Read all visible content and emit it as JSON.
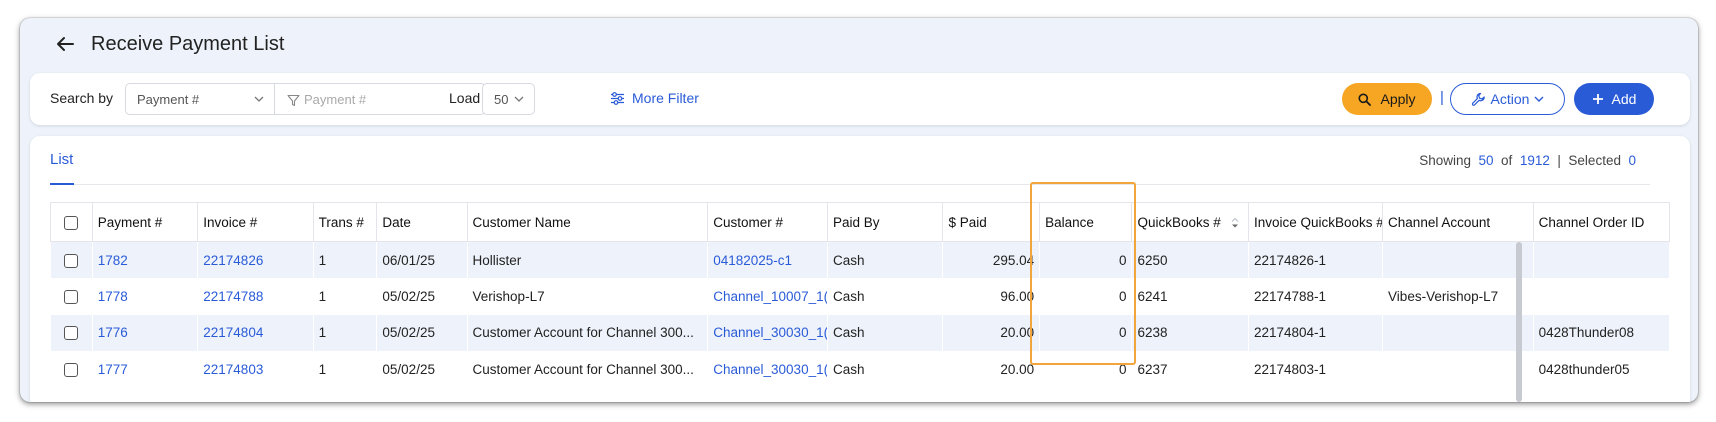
{
  "page": {
    "title": "Receive Payment List"
  },
  "filters": {
    "search_by_label": "Search by",
    "search_by_value": "Payment #",
    "search_placeholder": "Payment #",
    "load_label": "Load",
    "load_value": "50",
    "more_filter_label": "More Filter"
  },
  "actions": {
    "apply_label": "Apply",
    "separator": "|",
    "action_label": "Action",
    "add_label": "Add"
  },
  "list": {
    "tab_label": "List",
    "showing_label": "Showing",
    "showing_count": "50",
    "of_label": "of",
    "total": "1912",
    "sep": "|",
    "selected_label": "Selected",
    "selected_count": "0"
  },
  "table": {
    "columns": [
      "Payment #",
      "Invoice #",
      "Trans #",
      "Date",
      "Customer Name",
      "Customer #",
      "Paid By",
      "$ Paid",
      "Balance",
      "QuickBooks #",
      "Invoice QuickBooks #",
      "Channel Account",
      "Channel Order ID"
    ],
    "rows": [
      {
        "payment": "1782",
        "invoice": "22174826",
        "trans": "1",
        "date": "06/01/25",
        "customer_name": "Hollister",
        "customer_no": "04182025-c1",
        "paid_by": "Cash",
        "paid": "295.04",
        "balance": "0",
        "qb": "6250",
        "invoice_qb": "22174826-1",
        "channel_account": "",
        "channel_order": ""
      },
      {
        "payment": "1778",
        "invoice": "22174788",
        "trans": "1",
        "date": "05/02/25",
        "customer_name": "Verishop-L7",
        "customer_no": "Channel_10007_1(",
        "paid_by": "Cash",
        "paid": "96.00",
        "balance": "0",
        "qb": "6241",
        "invoice_qb": "22174788-1",
        "channel_account": "Vibes-Verishop-L7",
        "channel_order": ""
      },
      {
        "payment": "1776",
        "invoice": "22174804",
        "trans": "1",
        "date": "05/02/25",
        "customer_name": "Customer Account for Channel 300...",
        "customer_no": "Channel_30030_1(",
        "paid_by": "Cash",
        "paid": "20.00",
        "balance": "0",
        "qb": "6238",
        "invoice_qb": "22174804-1",
        "channel_account": "",
        "channel_order": "0428Thunder08"
      },
      {
        "payment": "1777",
        "invoice": "22174803",
        "trans": "1",
        "date": "05/02/25",
        "customer_name": "Customer Account for Channel 300...",
        "customer_no": "Channel_30030_1(",
        "paid_by": "Cash",
        "paid": "20.00",
        "balance": "0",
        "qb": "6237",
        "invoice_qb": "22174803-1",
        "channel_account": "",
        "channel_order": "0428thunder05"
      }
    ]
  },
  "colors": {
    "accent": "#2a5bd7",
    "apply": "#f6a623",
    "highlight": "#f2a53a",
    "row_alt": "#eef3fb"
  }
}
